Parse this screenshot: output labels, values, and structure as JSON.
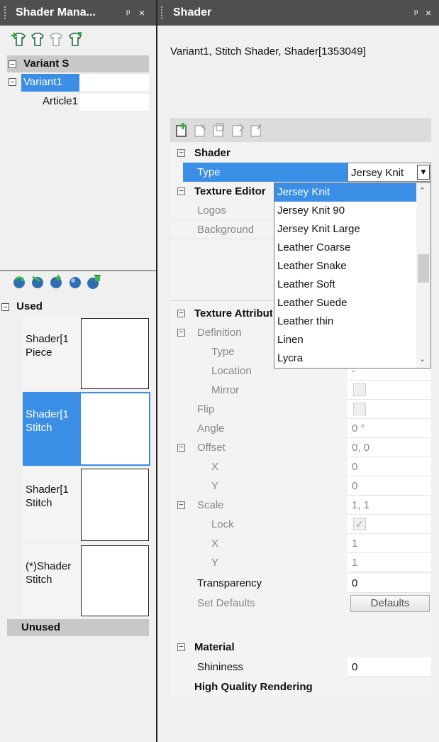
{
  "left_panel": {
    "title": "Shader Mana...",
    "pin": "ᵖ",
    "close": "×",
    "variant_tree": {
      "header": "Variant S",
      "items": [
        {
          "label": "Variant1",
          "value": ""
        },
        {
          "label": "Article1",
          "value": ""
        }
      ]
    },
    "groups": {
      "used": "Used",
      "unused": "Unused"
    },
    "shader_list": [
      {
        "line1": "Shader[1",
        "line2": "Piece",
        "selected": false
      },
      {
        "line1": "Shader[1",
        "line2": "Stitch",
        "selected": true
      },
      {
        "line1": "Shader[1",
        "line2": "Stitch",
        "selected": false
      },
      {
        "line1": "(*)Shader",
        "line2": "Stitch",
        "selected": false
      }
    ]
  },
  "right_panel": {
    "title": "Shader",
    "pin": "ᵖ",
    "close": "×",
    "description": "Variant1, Stitch Shader, Shader[1353049]",
    "categories": {
      "shader": "Shader",
      "texture_editor": "Texture Editor",
      "texture_attributes": "Texture Attributes",
      "material": "Material",
      "hq_rendering": "High Quality Rendering"
    },
    "properties": {
      "type": {
        "label": "Type",
        "value": "Jersey Knit"
      },
      "logos": {
        "label": "Logos"
      },
      "background": {
        "label": "Background"
      },
      "definition": {
        "label": "Definition"
      },
      "def_type": {
        "label": "Type"
      },
      "location": {
        "label": "Location",
        "value": "-"
      },
      "mirror": {
        "label": "Mirror"
      },
      "flip": {
        "label": "Flip"
      },
      "angle": {
        "label": "Angle",
        "value": "0 °"
      },
      "offset": {
        "label": "Offset",
        "value": "0, 0"
      },
      "offset_x": {
        "label": "X",
        "value": "0"
      },
      "offset_y": {
        "label": "Y",
        "value": "0"
      },
      "scale": {
        "label": "Scale",
        "value": "1, 1"
      },
      "lock": {
        "label": "Lock",
        "value": "✓"
      },
      "scale_x": {
        "label": "X",
        "value": "1"
      },
      "scale_y": {
        "label": "Y",
        "value": "1"
      },
      "transparency": {
        "label": "Transparency",
        "value": "0"
      },
      "set_defaults": {
        "label": "Set Defaults",
        "button": "Defaults"
      },
      "shininess": {
        "label": "Shininess",
        "value": "0"
      }
    },
    "type_dropdown": {
      "selected": "Jersey Knit",
      "options": [
        "Jersey Knit",
        "Jersey Knit 90",
        "Jersey Knit Large",
        "Leather Coarse",
        "Leather Snake",
        "Leather Soft",
        "Leather Suede",
        "Leather thin",
        "Linen",
        "Lycra"
      ]
    }
  },
  "colors": {
    "header": "#4f4f4f",
    "selection": "#3a8ee6",
    "panel": "#f0f0f0"
  }
}
